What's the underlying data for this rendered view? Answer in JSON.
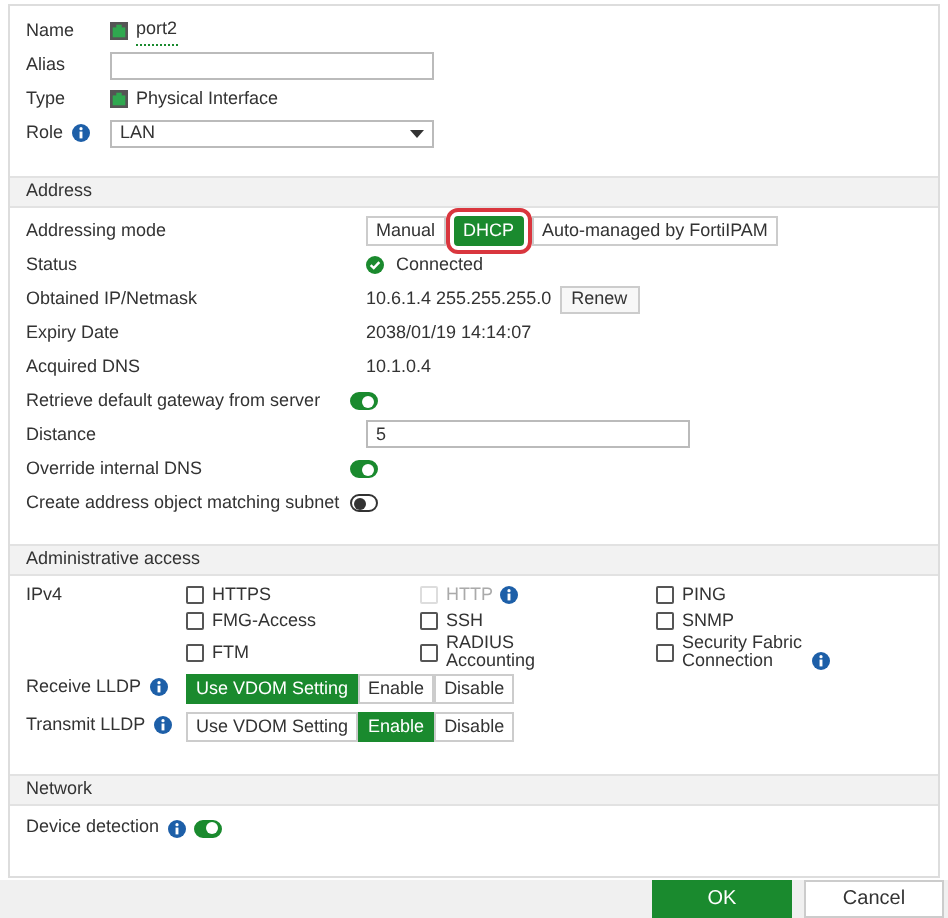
{
  "interface": [
    {
      "kind": "link",
      "label": "Name",
      "value": "port2"
    },
    {
      "kind": "input",
      "label": "Alias"
    },
    {
      "kind": "text-icon",
      "label": "Type",
      "value": "Physical Interface"
    },
    {
      "kind": "select",
      "label": "Role",
      "info": true,
      "value": "LAN"
    }
  ],
  "sections": [
    {
      "title": "Address",
      "rows": [
        {
          "kind": "segmented",
          "label": "Addressing mode",
          "options": [
            {
              "label": "Manual",
              "selected": false,
              "highlighted": false
            },
            {
              "label": "DHCP",
              "selected": true,
              "highlighted": true
            },
            {
              "label": "Auto-managed by FortiIPAM",
              "selected": false,
              "highlighted": false
            }
          ]
        },
        {
          "kind": "status",
          "label": "Status",
          "value": "Connected"
        },
        {
          "kind": "text-button",
          "label": "Obtained IP/Netmask",
          "value": "10.6.1.4 255.255.255.0",
          "button": "Renew"
        },
        {
          "kind": "text",
          "label": "Expiry Date",
          "value": "2038/01/19 14:14:07"
        },
        {
          "kind": "text",
          "label": "Acquired DNS",
          "value": "10.1.0.4"
        },
        {
          "kind": "toggle",
          "label": "Retrieve default gateway from server",
          "on": true
        },
        {
          "kind": "input",
          "label": "Distance",
          "value": "5"
        },
        {
          "kind": "toggle",
          "label": "Override internal DNS",
          "on": true
        },
        {
          "kind": "toggle",
          "label": "Create address object matching subnet",
          "on": false
        }
      ]
    },
    {
      "title": "Administrative access",
      "rows": [
        {
          "kind": "checkboxes",
          "label": "IPv4",
          "items": [
            {
              "label": "HTTPS",
              "checked": false,
              "disabled": false,
              "info": false
            },
            {
              "label": "HTTP",
              "checked": false,
              "disabled": true,
              "info": true
            },
            {
              "label": "PING",
              "checked": false,
              "disabled": false,
              "info": false
            },
            {
              "label": "FMG-Access",
              "checked": false,
              "disabled": false,
              "info": false
            },
            {
              "label": "SSH",
              "checked": false,
              "disabled": false,
              "info": false
            },
            {
              "label": "SNMP",
              "checked": false,
              "disabled": false,
              "info": false
            },
            {
              "label": "FTM",
              "checked": false,
              "disabled": false,
              "info": false
            },
            {
              "label": "RADIUS Accounting",
              "checked": false,
              "disabled": false,
              "info": false
            },
            {
              "label": "Security Fabric Connection",
              "checked": false,
              "disabled": false,
              "info": true
            }
          ]
        },
        {
          "kind": "segmented",
          "label": "Receive LLDP",
          "info": true,
          "options": [
            {
              "label": "Use VDOM Setting",
              "selected": true,
              "highlighted": false
            },
            {
              "label": "Enable",
              "selected": false,
              "highlighted": false
            },
            {
              "label": "Disable",
              "selected": false,
              "highlighted": false
            }
          ]
        },
        {
          "kind": "segmented",
          "label": "Transmit LLDP",
          "info": true,
          "options": [
            {
              "label": "Use VDOM Setting",
              "selected": false,
              "highlighted": false
            },
            {
              "label": "Enable",
              "selected": true,
              "highlighted": false
            },
            {
              "label": "Disable",
              "selected": false,
              "highlighted": false
            }
          ]
        }
      ]
    },
    {
      "title": "Network",
      "rows": [
        {
          "kind": "toggle",
          "label": "Device detection",
          "info": true,
          "on": true
        }
      ]
    }
  ],
  "buttons": [
    {
      "label": "OK",
      "kind": "primary"
    },
    {
      "label": "Cancel",
      "kind": "secondary"
    }
  ]
}
